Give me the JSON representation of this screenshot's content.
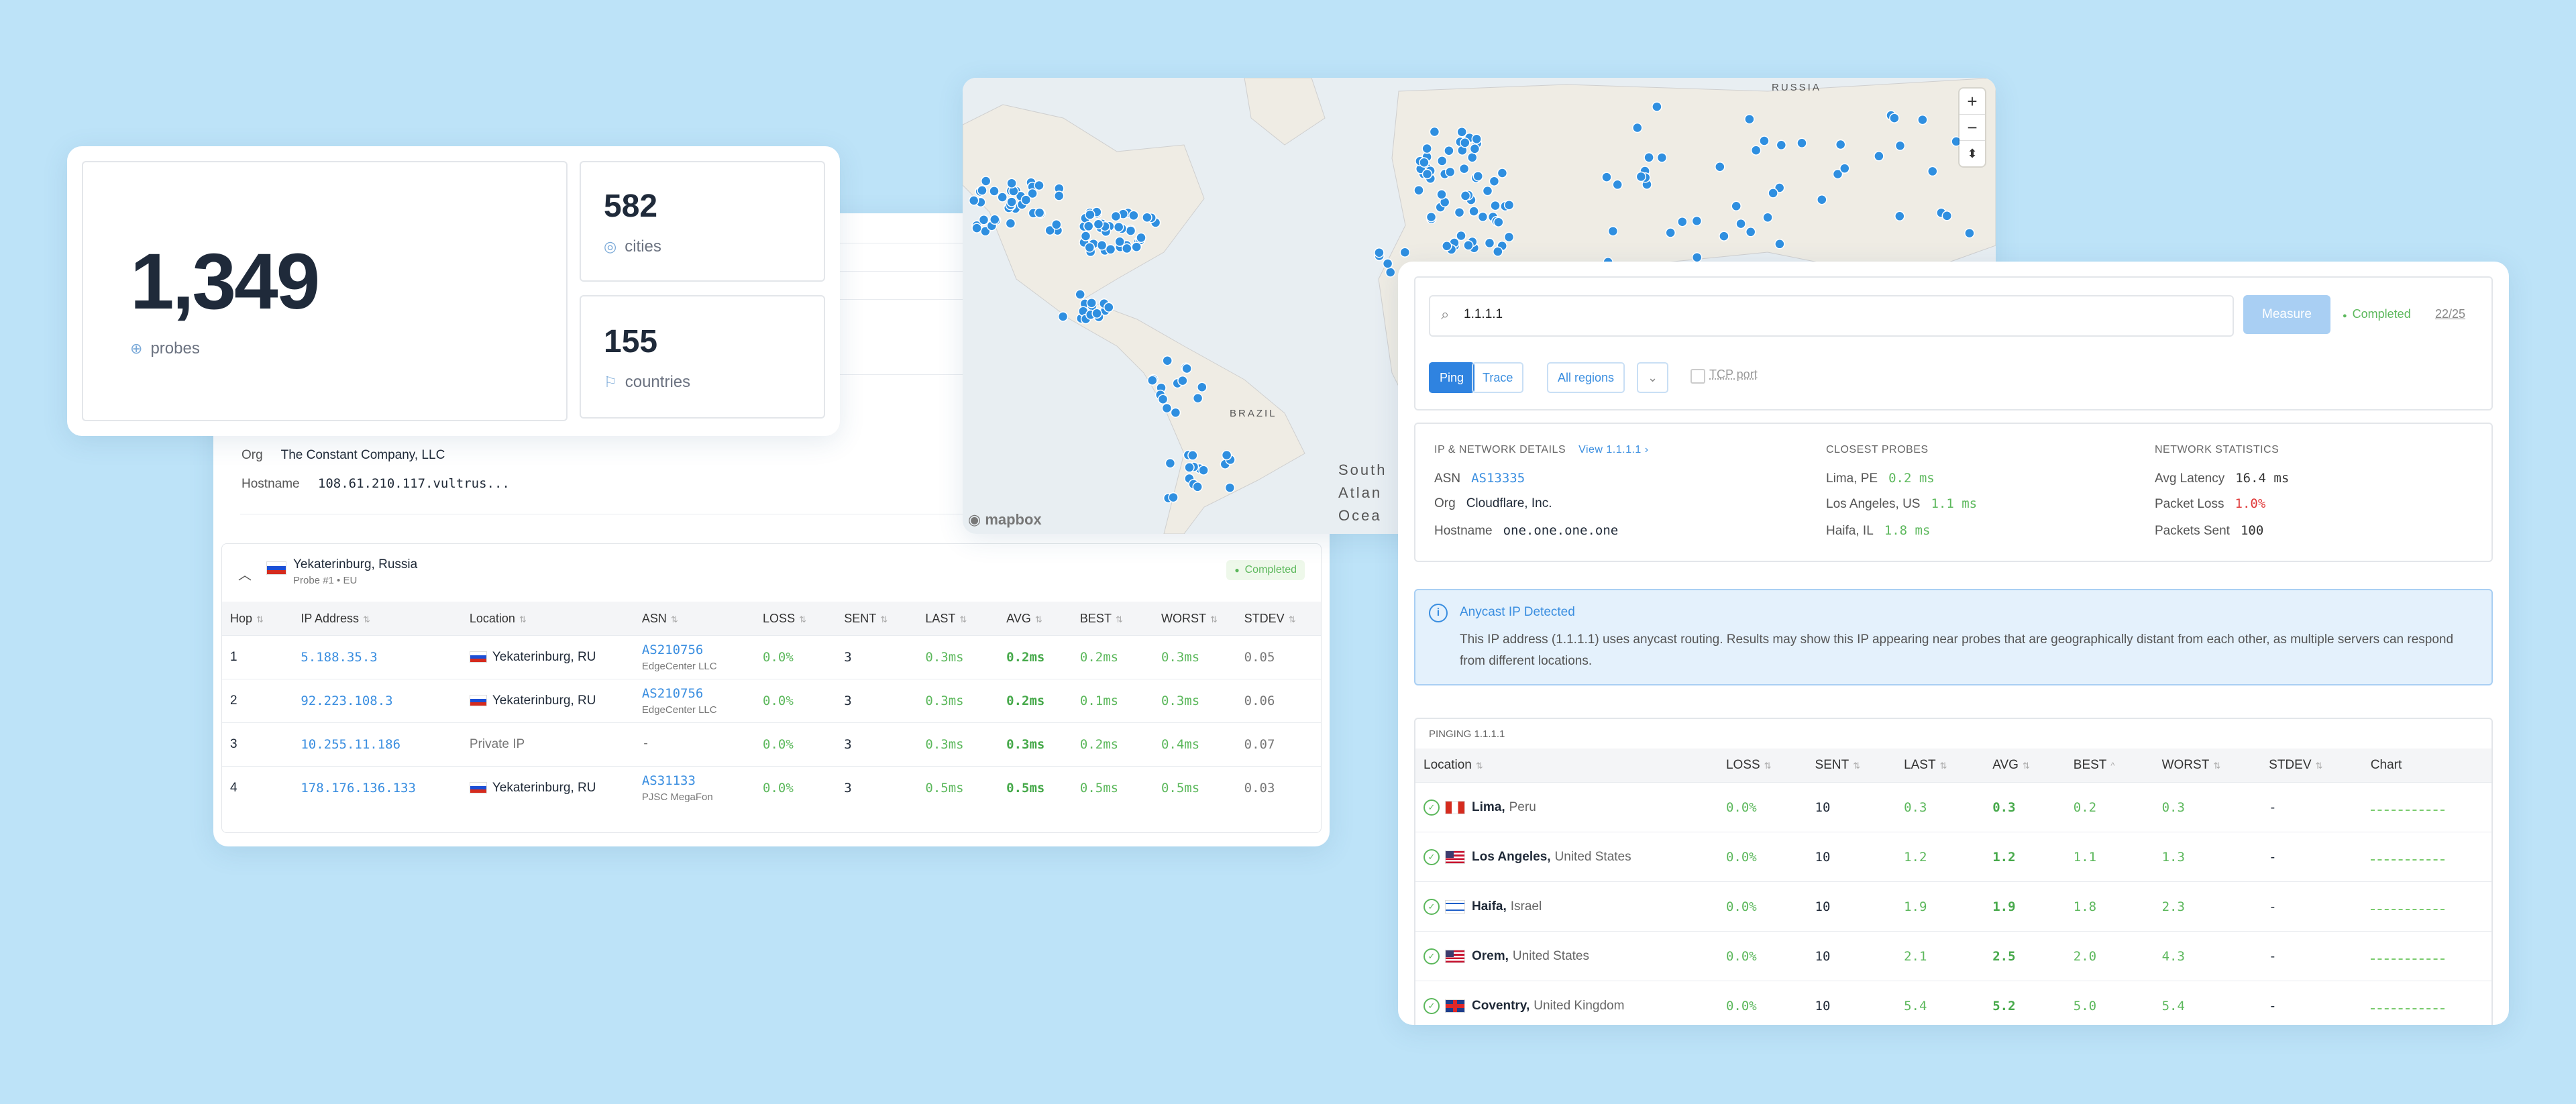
{
  "stats": {
    "probes_count": "1,349",
    "probes_label": "probes",
    "cities_count": "582",
    "cities_label": "cities",
    "countries_count": "155",
    "countries_label": "countries"
  },
  "traceroute": {
    "org_label": "Org",
    "org_value": "The Constant Company, LLC",
    "hostname_label": "Hostname",
    "hostname_value": "108.61.210.117.vultrus...",
    "probe_location": "Yekaterinburg, Russia",
    "probe_sub": "Probe #1 • EU",
    "status": "Completed",
    "columns": [
      "Hop",
      "IP Address",
      "Location",
      "ASN",
      "LOSS",
      "SENT",
      "LAST",
      "AVG",
      "BEST",
      "WORST",
      "STDEV"
    ],
    "rows": [
      {
        "hop": "1",
        "ip": "5.188.35.3",
        "location": "Yekaterinburg, RU",
        "asn": "AS210756",
        "asn_org": "EdgeCenter LLC",
        "loss": "0.0%",
        "sent": "3",
        "last": "0.3ms",
        "avg": "0.2ms",
        "best": "0.2ms",
        "worst": "0.3ms",
        "stdev": "0.05"
      },
      {
        "hop": "2",
        "ip": "92.223.108.3",
        "location": "Yekaterinburg, RU",
        "asn": "AS210756",
        "asn_org": "EdgeCenter LLC",
        "loss": "0.0%",
        "sent": "3",
        "last": "0.3ms",
        "avg": "0.2ms",
        "best": "0.1ms",
        "worst": "0.3ms",
        "stdev": "0.06"
      },
      {
        "hop": "3",
        "ip": "10.255.11.186",
        "location": "Private IP",
        "asn": "-",
        "asn_org": "",
        "loss": "0.0%",
        "sent": "3",
        "last": "0.3ms",
        "avg": "0.3ms",
        "best": "0.2ms",
        "worst": "0.4ms",
        "stdev": "0.07"
      },
      {
        "hop": "4",
        "ip": "178.176.136.133",
        "location": "Yekaterinburg, RU",
        "asn": "AS31133",
        "asn_org": "PJSC MegaFon",
        "loss": "0.0%",
        "sent": "3",
        "last": "0.5ms",
        "avg": "0.5ms",
        "best": "0.5ms",
        "worst": "0.5ms",
        "stdev": "0.03"
      }
    ]
  },
  "map": {
    "labels": {
      "russia": "RUSSIA",
      "brazil": "BRAZIL",
      "ocean": "South\nAtlan\nOcea"
    },
    "attribution": "mapbox",
    "zoom_in": "+",
    "zoom_out": "−",
    "compass": "⬍"
  },
  "ping": {
    "search_value": "1.1.1.1",
    "measure_label": "Measure",
    "status": "Completed",
    "count": "22/25",
    "tabs": {
      "ping": "Ping",
      "trace": "Trace"
    },
    "region": "All regions",
    "tcp_label": "TCP port",
    "details": {
      "ip_header": "IP & NETWORK DETAILS",
      "view_link": "View 1.1.1.1 ›",
      "asn_label": "ASN",
      "asn_value": "AS13335",
      "org_label": "Org",
      "org_value": "Cloudflare, Inc.",
      "hostname_label": "Hostname",
      "hostname_value": "one.one.one.one",
      "closest_header": "CLOSEST PROBES",
      "closest": [
        {
          "name": "Lima, PE",
          "value": "0.2 ms"
        },
        {
          "name": "Los Angeles, US",
          "value": "1.1 ms"
        },
        {
          "name": "Haifa, IL",
          "value": "1.8 ms"
        }
      ],
      "net_header": "NETWORK STATISTICS",
      "avg_latency_label": "Avg Latency",
      "avg_latency_value": "16.4 ms",
      "packet_loss_label": "Packet Loss",
      "packet_loss_value": "1.0%",
      "packets_sent_label": "Packets Sent",
      "packets_sent_value": "100"
    },
    "anycast": {
      "title": "Anycast IP Detected",
      "body": "This IP address (1.1.1.1) uses anycast routing. Results may show this IP appearing near probes that are geographically distant from each other, as multiple servers can respond from different locations."
    },
    "results_title": "PINGING 1.1.1.1",
    "columns": [
      "Location",
      "LOSS",
      "SENT",
      "LAST",
      "AVG",
      "BEST",
      "WORST",
      "STDEV",
      "Chart"
    ],
    "rows": [
      {
        "city": "Lima,",
        "country": "Peru",
        "flag": "pe",
        "loss": "0.0%",
        "sent": "10",
        "last": "0.3",
        "avg": "0.3",
        "best": "0.2",
        "worst": "0.3",
        "stdev": "-"
      },
      {
        "city": "Los Angeles,",
        "country": "United States",
        "flag": "us",
        "loss": "0.0%",
        "sent": "10",
        "last": "1.2",
        "avg": "1.2",
        "best": "1.1",
        "worst": "1.3",
        "stdev": "-"
      },
      {
        "city": "Haifa,",
        "country": "Israel",
        "flag": "il",
        "loss": "0.0%",
        "sent": "10",
        "last": "1.9",
        "avg": "1.9",
        "best": "1.8",
        "worst": "2.3",
        "stdev": "-"
      },
      {
        "city": "Orem,",
        "country": "United States",
        "flag": "us",
        "loss": "0.0%",
        "sent": "10",
        "last": "2.1",
        "avg": "2.5",
        "best": "2.0",
        "worst": "4.3",
        "stdev": "-"
      },
      {
        "city": "Coventry,",
        "country": "United Kingdom",
        "flag": "gb",
        "loss": "0.0%",
        "sent": "10",
        "last": "5.4",
        "avg": "5.2",
        "best": "5.0",
        "worst": "5.4",
        "stdev": "-"
      }
    ]
  }
}
